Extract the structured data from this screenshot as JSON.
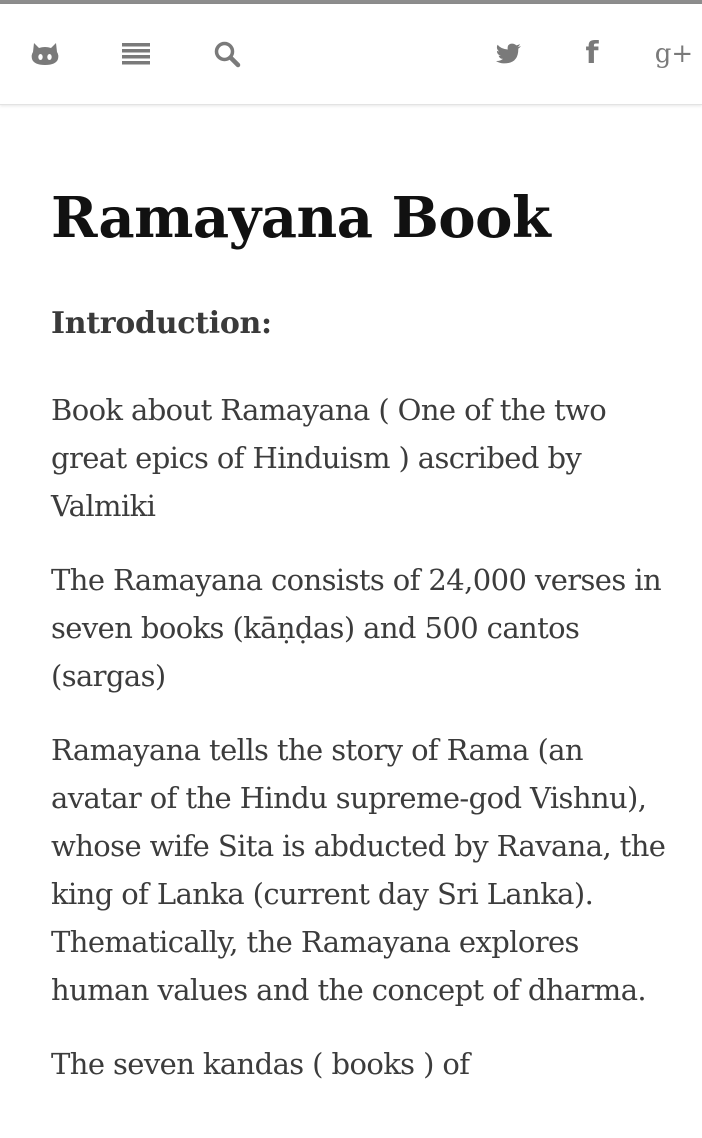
{
  "toolbar": {
    "left_icons": [
      "github-icon",
      "menu-list-icon",
      "search-icon"
    ],
    "right_icons": [
      "twitter-icon",
      "facebook-icon",
      "google-plus-icon"
    ],
    "facebook_glyph": "f",
    "google_plus_glyph": "g+",
    "icon_color": "#7a7a7a"
  },
  "page": {
    "title": "Ramayana Book",
    "section_heading": "Introduction:",
    "paragraphs": [
      "Book about Ramayana ( One of the two great epics of Hinduism ) ascribed by Valmiki",
      "The Ramayana consists of 24,000 verses in seven books (kāṇḍas) and 500 cantos (sargas)",
      "Ramayana tells the story of Rama (an avatar of the Hindu supreme-god Vishnu), whose wife Sita is abducted by Ravana, the king of Lanka (current day Sri Lanka). Thematically, the Ramayana explores human values and the concept of dharma.",
      "The seven kandas ( books ) of"
    ]
  },
  "colors": {
    "title": "#111111",
    "body_text": "#3c3c3c",
    "toolbar_bg": "#ffffff",
    "top_line": "#8d8d8d"
  }
}
